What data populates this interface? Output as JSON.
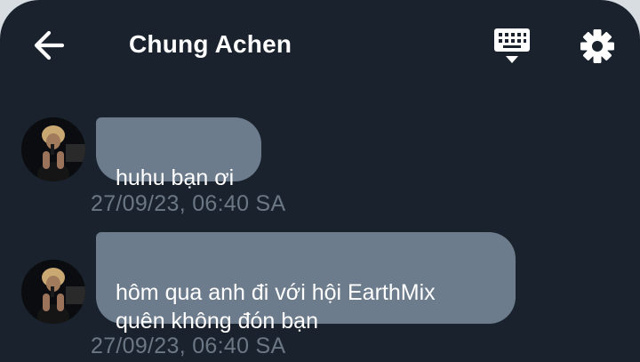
{
  "header": {
    "title": "Chung Achen",
    "back_icon": "arrow-left-icon",
    "keyboard_icon": "keyboard-icon",
    "settings_icon": "gear-icon"
  },
  "messages": [
    {
      "text": "huhu bạn ơi",
      "time": "27/09/23, 06:40 SA"
    },
    {
      "text": "hôm qua anh đi với hội EarthMix\nquên không đón bạn",
      "time": "27/09/23, 06:40 SA"
    }
  ],
  "colors": {
    "background": "#1a232d",
    "bubble": "#6d7c8c",
    "timestamp": "#6b7785",
    "text": "#ffffff"
  }
}
